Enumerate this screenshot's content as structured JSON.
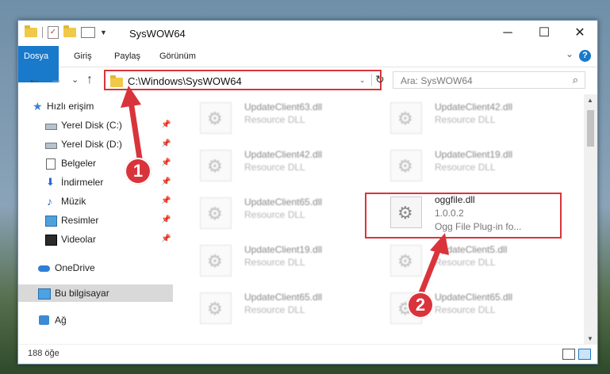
{
  "window": {
    "title": "SysWOW64",
    "minimize": "─",
    "maximize": "☐",
    "close": "✕"
  },
  "ribbon": {
    "tabs": [
      "Dosya",
      "Giriş",
      "Paylaş",
      "Görünüm"
    ],
    "collapse": "⌄",
    "help": "?"
  },
  "navigation": {
    "back": "←",
    "forward": "→",
    "recent": "⌄",
    "up": "↑",
    "address": "C:\\Windows\\SysWOW64",
    "address_dropdown": "⌄",
    "refresh": "↻",
    "search_placeholder": "Ara: SysWOW64",
    "search_icon": "⌕"
  },
  "sidebar": {
    "items": [
      {
        "label": "Hızlı erişim",
        "icon": "star-icon",
        "pinned": false
      },
      {
        "label": "Yerel Disk (C:)",
        "icon": "drive-icon",
        "pinned": true
      },
      {
        "label": "Yerel Disk (D:)",
        "icon": "drive-icon",
        "pinned": true
      },
      {
        "label": "Belgeler",
        "icon": "document-icon",
        "pinned": true
      },
      {
        "label": "İndirmeler",
        "icon": "download-icon",
        "pinned": true
      },
      {
        "label": "Müzik",
        "icon": "music-icon",
        "pinned": true
      },
      {
        "label": "Resimler",
        "icon": "pictures-icon",
        "pinned": true
      },
      {
        "label": "Videolar",
        "icon": "video-icon",
        "pinned": true
      },
      {
        "label": "OneDrive",
        "icon": "cloud-icon",
        "pinned": false
      },
      {
        "label": "Bu bilgisayar",
        "icon": "computer-icon",
        "pinned": false,
        "selected": true
      },
      {
        "label": "Ağ",
        "icon": "network-icon",
        "pinned": false
      }
    ],
    "pin_glyph": "📌"
  },
  "files": [
    {
      "name": "UpdateClient63.dll",
      "type": "Resource DLL",
      "blurred": true
    },
    {
      "name": "UpdateClient42.dll",
      "type": "Resource DLL",
      "blurred": true
    },
    {
      "name": "UpdateClient42.dll",
      "type": "Resource DLL",
      "blurred": true
    },
    {
      "name": "UpdateClient19.dll",
      "type": "Resource DLL",
      "blurred": true
    },
    {
      "name": "UpdateClient65.dll",
      "type": "Resource DLL",
      "blurred": true
    },
    {
      "name": "oggfile.dll",
      "version": "1.0.0.2",
      "type": "Ogg File Plug-in fo...",
      "blurred": false,
      "highlighted": true
    },
    {
      "name": "UpdateClient19.dll",
      "type": "Resource DLL",
      "blurred": true
    },
    {
      "name": "UpdateClient5.dll",
      "type": "Resource DLL",
      "blurred": true
    },
    {
      "name": "UpdateClient65.dll",
      "type": "Resource DLL",
      "blurred": true
    },
    {
      "name": "UpdateClient65.dll",
      "type": "Resource DLL",
      "blurred": true
    }
  ],
  "status": {
    "item_count": "188 öğe"
  },
  "callouts": [
    "1",
    "2"
  ],
  "colors": {
    "accent": "#1979ca",
    "highlight": "#d9343b",
    "selection": "#d9d9d9"
  }
}
